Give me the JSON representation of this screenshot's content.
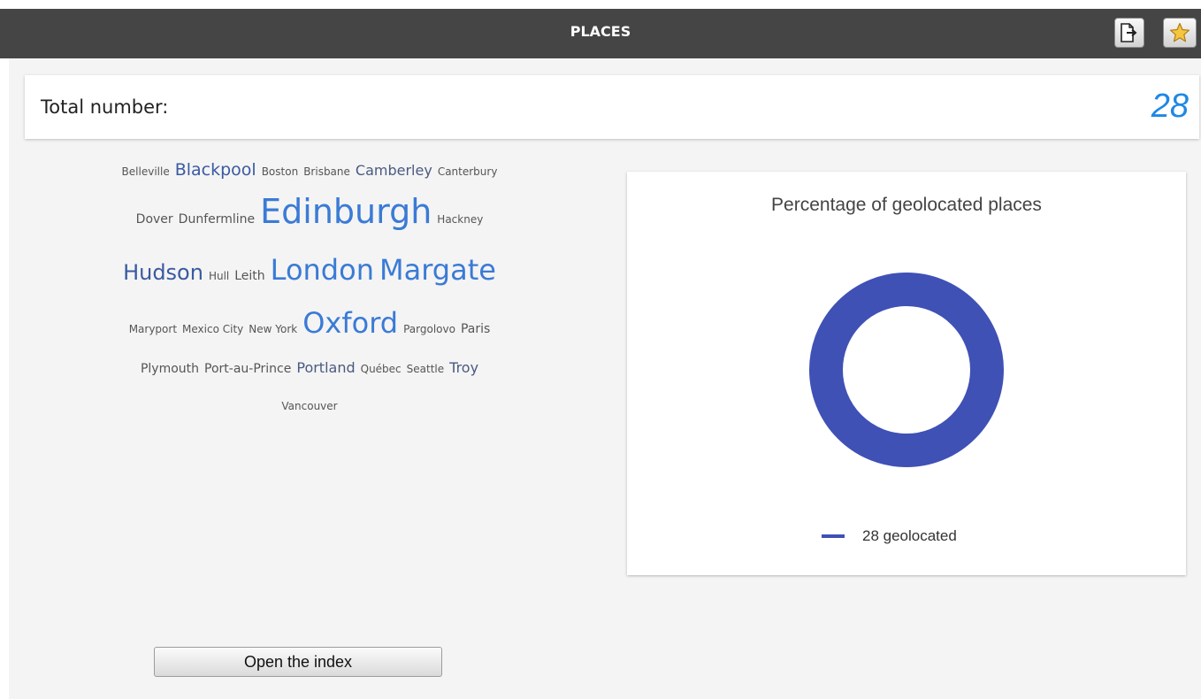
{
  "header": {
    "title": "PLACES",
    "export_icon": "export-icon",
    "favorite_icon": "star-icon"
  },
  "summary": {
    "label": "Total number:",
    "value": "28"
  },
  "word_cloud": {
    "lines": [
      [
        {
          "text": "Belleville",
          "size": "s1"
        },
        {
          "text": "Blackpool",
          "size": "s4"
        },
        {
          "text": "Boston",
          "size": "s1"
        },
        {
          "text": "Brisbane",
          "size": "s1"
        },
        {
          "text": "Camberley",
          "size": "s3"
        },
        {
          "text": "Canterbury",
          "size": "s1"
        }
      ],
      [
        {
          "text": "Dover",
          "size": "s2"
        },
        {
          "text": "Dunfermline",
          "size": "s2"
        },
        {
          "text": "Edinburgh",
          "size": "s7"
        },
        {
          "text": "Hackney",
          "size": "s1"
        }
      ],
      [
        {
          "text": "Hudson",
          "size": "s5"
        },
        {
          "text": "Hull",
          "size": "s1"
        },
        {
          "text": "Leith",
          "size": "s2"
        },
        {
          "text": "London",
          "size": "s6"
        },
        {
          "text": "Margate",
          "size": "s6"
        }
      ],
      [
        {
          "text": "Maryport",
          "size": "s1"
        },
        {
          "text": "Mexico City",
          "size": "s1"
        },
        {
          "text": "New York",
          "size": "s1"
        },
        {
          "text": "Oxford",
          "size": "s6"
        },
        {
          "text": "Pargolovo",
          "size": "s1"
        },
        {
          "text": "Paris",
          "size": "s2"
        }
      ],
      [
        {
          "text": "Plymouth",
          "size": "s2"
        },
        {
          "text": "Port-au-Prince",
          "size": "s2"
        },
        {
          "text": "Portland",
          "size": "s3"
        },
        {
          "text": "Québec",
          "size": "s1"
        },
        {
          "text": "Seattle",
          "size": "s1"
        },
        {
          "text": "Troy",
          "size": "s3"
        }
      ],
      [
        {
          "text": "Vancouver",
          "size": "s1"
        }
      ]
    ]
  },
  "chart_data": {
    "type": "pie",
    "title": "Percentage of geolocated places",
    "categories": [
      "geolocated"
    ],
    "values": [
      28
    ],
    "colors": [
      "#3f51b5"
    ],
    "legend": "bottom",
    "legend_labels": [
      "28 geolocated"
    ]
  },
  "actions": {
    "open_index_label": "Open the index"
  }
}
